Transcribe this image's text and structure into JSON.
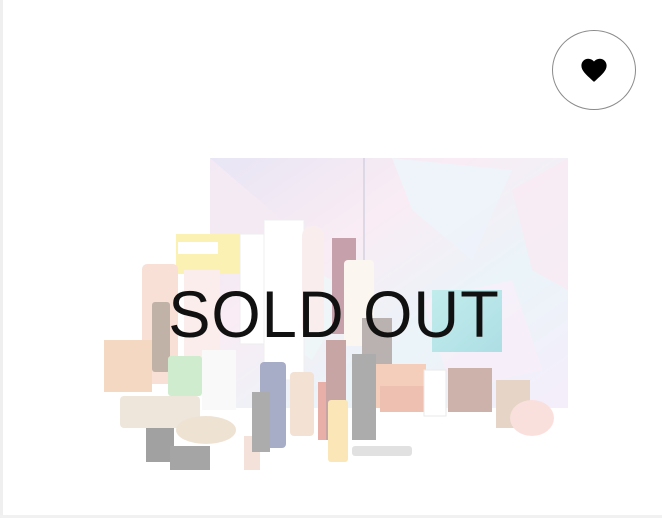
{
  "product": {
    "image": "beauty-advent-calendar",
    "status_text": "SOLD OUT"
  },
  "actions": {
    "favorite_icon": "heart-icon"
  },
  "colors": {
    "overlay_text": "#111111",
    "favorite_border": "#8a8a8a",
    "heart": "#000000"
  }
}
